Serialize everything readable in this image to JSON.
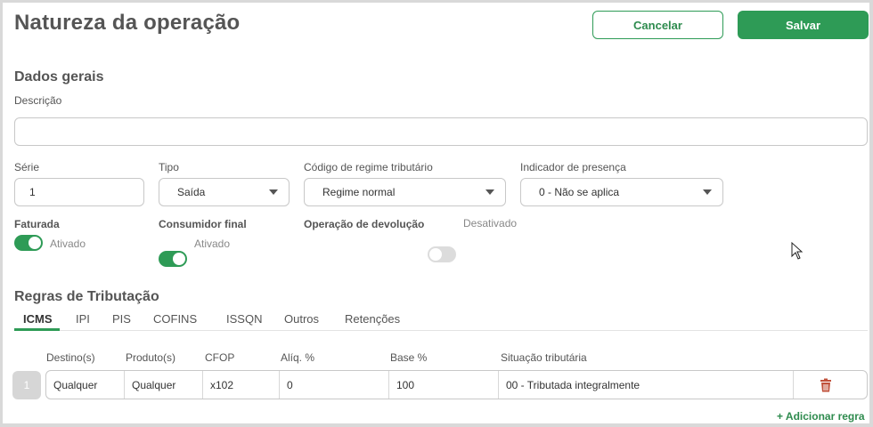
{
  "page": {
    "title": "Natureza da operação",
    "cancel_label": "Cancelar",
    "save_label": "Salvar"
  },
  "dados_gerais": {
    "heading": "Dados gerais",
    "descricao_label": "Descrição",
    "descricao_value": "",
    "serie_label": "Série",
    "serie_value": "1",
    "tipo_label": "Tipo",
    "tipo_value": "Saída",
    "regime_label": "Código de regime tributário",
    "regime_value": "Regime normal",
    "presenca_label": "Indicador de presença",
    "presenca_value": "0 - Não se aplica",
    "faturada_label": "Faturada",
    "faturada_state": "Ativado",
    "consumidor_label": "Consumidor final",
    "consumidor_state": "Ativado",
    "devolucao_label": "Operação de devolução",
    "devolucao_state": "Desativado"
  },
  "regras": {
    "heading": "Regras de Tributação",
    "tabs": [
      "ICMS",
      "IPI",
      "PIS",
      "COFINS",
      "ISSQN",
      "Outros",
      "Retenções"
    ],
    "active_tab": "ICMS",
    "columns": [
      "Destino(s)",
      "Produto(s)",
      "CFOP",
      "Alíq. %",
      "Base %",
      "Situação tributária"
    ],
    "rows": [
      {
        "num": "1",
        "destino": "Qualquer",
        "produto": "Qualquer",
        "cfop": "x102",
        "aliq": "0",
        "base": "100",
        "situacao": "00 - Tributada integralmente"
      }
    ],
    "add_label": "Adicionar regra"
  },
  "colors": {
    "accent": "#2e9b56",
    "danger": "#c0503a"
  }
}
